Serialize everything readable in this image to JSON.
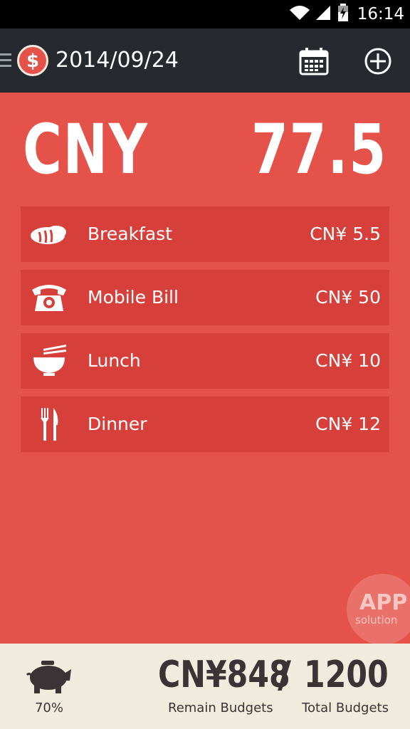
{
  "status_bar": {
    "time": "16:14",
    "icons": [
      "wifi-icon",
      "signal-icon",
      "battery-icon"
    ]
  },
  "toolbar": {
    "date": "2014/09/24",
    "icons": [
      "menu-icon",
      "dollar-logo-icon",
      "calendar-icon",
      "add-circle-icon"
    ]
  },
  "summary": {
    "currency": "CNY",
    "total": "77.5"
  },
  "expenses": [
    {
      "icon": "bread-icon",
      "name": "Breakfast",
      "amount": "CN¥ 5.5"
    },
    {
      "icon": "telephone-icon",
      "name": "Mobile Bill",
      "amount": "CN¥ 50"
    },
    {
      "icon": "noodle-bowl-icon",
      "name": "Lunch",
      "amount": "CN¥ 10"
    },
    {
      "icon": "fork-knife-icon",
      "name": "Dinner",
      "amount": "CN¥ 12"
    }
  ],
  "watermark": {
    "line1": "APP",
    "line2": "solution"
  },
  "budget": {
    "icon": "piggy-bank-icon",
    "percent_label": "70%",
    "remain_value": "CN¥848",
    "separator": "/",
    "total_value": "1200",
    "remain_label": "Remain Budgets",
    "total_label": "Total Budgets"
  },
  "colors": {
    "accent_red": "#e4524a",
    "row_red": "#d7403a",
    "toolbar_dark": "#26292d",
    "footer_cream": "#f1ebdd",
    "footer_text": "#3a3436"
  }
}
